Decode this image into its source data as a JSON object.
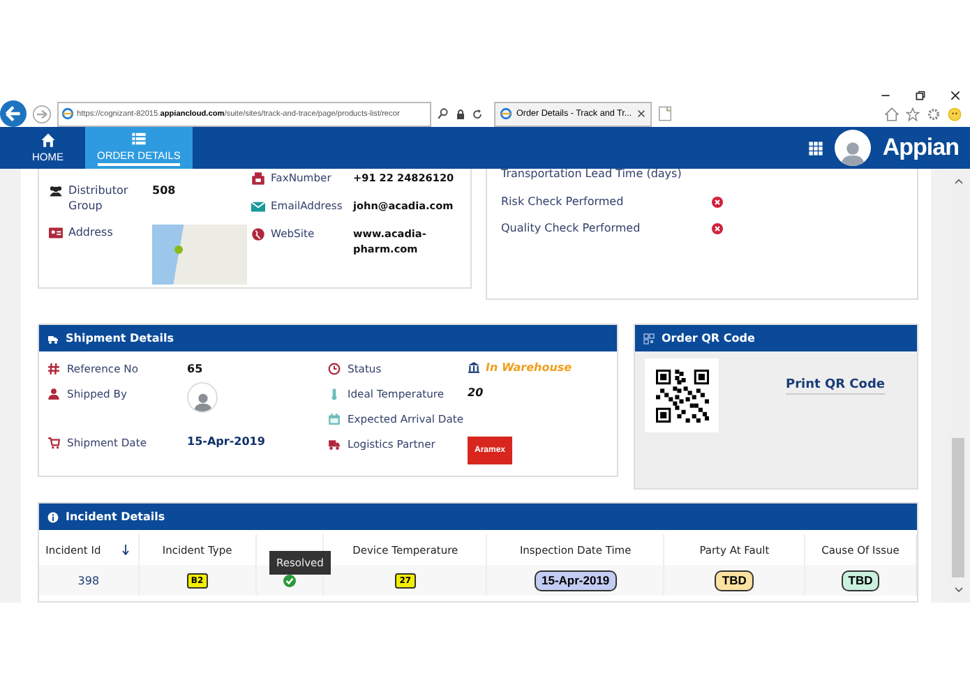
{
  "browser": {
    "url": "https://cognizant-82015.**appiancloud.com**/suite/sites/track-and-trace/page/products-list/recor",
    "tab_title": "Order Details - Track and Tr..."
  },
  "nav": {
    "items": [
      {
        "label": "HOME",
        "selected": false
      },
      {
        "label": "ORDER DETAILS",
        "selected": true
      }
    ],
    "brand": "Appian"
  },
  "customer_card": {
    "columns": [
      [
        {
          "label": "Distributor Group",
          "kind": "text",
          "value": "508"
        },
        {
          "label": "Address",
          "kind": "map"
        }
      ],
      [
        {
          "label": "FaxNumber",
          "kind": "text",
          "value": "+91 22 24826120"
        },
        {
          "label": "EmailAddress",
          "kind": "text",
          "value": "john@acadia.com"
        },
        {
          "label": "WebSite",
          "kind": "text",
          "value": "www.acadia-pharm.com"
        }
      ]
    ]
  },
  "checks_card": {
    "heading": "Transportation Lead Time (days)",
    "rows": [
      {
        "label": "Risk Check Performed",
        "checked": false
      },
      {
        "label": "Quality Check Performed",
        "checked": false
      }
    ]
  },
  "shipment": {
    "title": "Shipment Details",
    "columns": [
      [
        {
          "label": "Reference No",
          "kind": "text",
          "value": "65"
        },
        {
          "label": "Shipped By",
          "kind": "avatar"
        },
        {
          "label": "Shipment Date",
          "kind": "date",
          "value": "15-Apr-2019"
        }
      ],
      [
        {
          "label": "Status",
          "kind": "status",
          "value": "In Warehouse"
        },
        {
          "label": "Ideal Temperature",
          "kind": "italic",
          "value": "20"
        },
        {
          "label": "Expected Arrival Date",
          "kind": "empty"
        },
        {
          "label": "Logistics Partner",
          "kind": "logo",
          "value": "Aramex"
        }
      ]
    ]
  },
  "qr": {
    "title": "Order QR Code",
    "link": "Print QR Code"
  },
  "incidents": {
    "title": "Incident Details",
    "columns": [
      {
        "label": "Incident Id",
        "sorted": true
      },
      {
        "label": "Incident Type",
        "sorted": false
      },
      {
        "sorted": false
      },
      {
        "label": "Device Temperature",
        "sorted": false
      },
      {
        "label": "Inspection Date Time",
        "sorted": false
      },
      {
        "label": "Party At Fault",
        "sorted": false
      },
      {
        "label": "Cause Of Issue",
        "sorted": false
      }
    ],
    "rows": [
      {
        "cells": [
          {
            "kind": "link",
            "text": "398"
          },
          {
            "kind": "tag",
            "text": "B2",
            "color": "#f2ee00"
          },
          {
            "kind": "check",
            "checked": true
          },
          {
            "kind": "tag",
            "text": "27",
            "color": "#f2ee00"
          },
          {
            "kind": "pill",
            "text": "15-Apr-2019",
            "color": "#c3cdf3"
          },
          {
            "kind": "pill",
            "text": "TBD",
            "color": "#fbe2a0"
          },
          {
            "kind": "pill",
            "text": "TBD",
            "color": "#c9f1dd"
          }
        ]
      }
    ],
    "tooltip": "Resolved"
  }
}
